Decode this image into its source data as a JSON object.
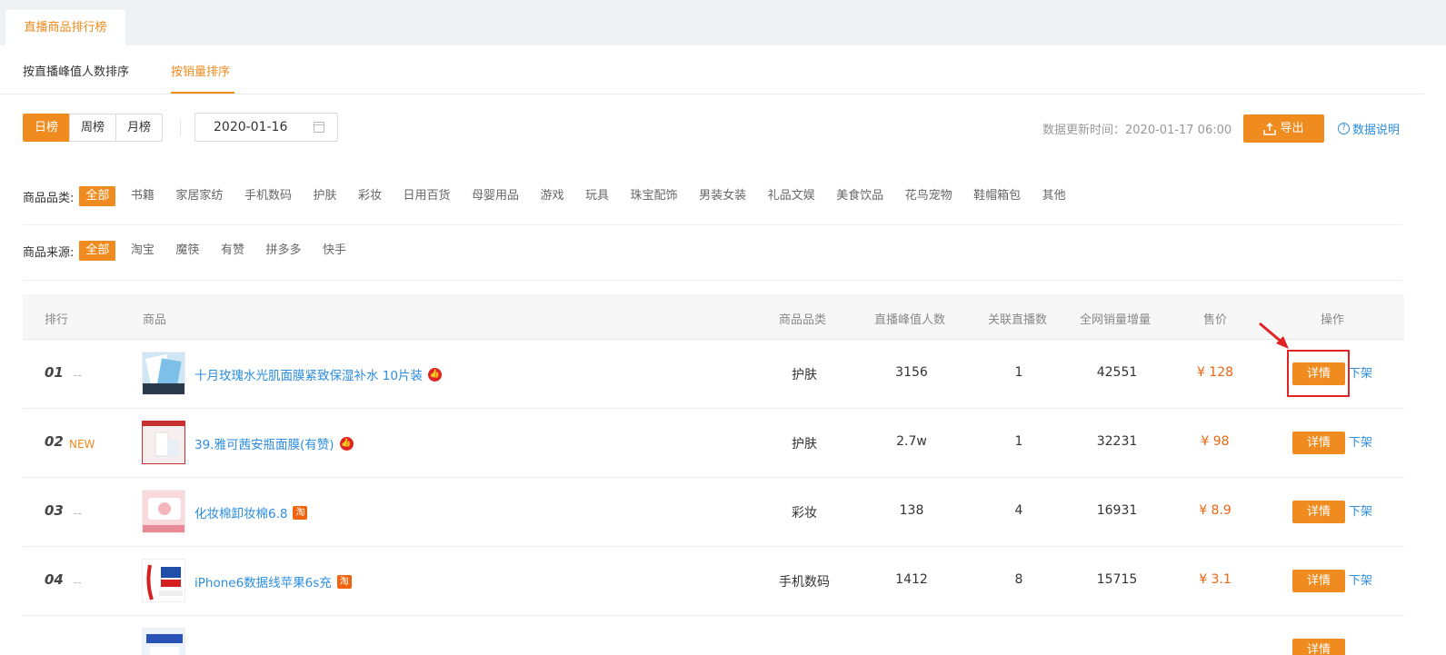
{
  "top_tab": "直播商品排行榜",
  "subtabs": [
    "按直播峰值人数排序",
    "按销量排序"
  ],
  "periods": [
    "日榜",
    "周榜",
    "月榜"
  ],
  "date_value": "2020-01-16",
  "update_text": "数据更新时间：2020-01-17 06:00",
  "export_label": "导出",
  "help_label": "数据说明",
  "category": {
    "label": "商品品类:",
    "options": [
      "全部",
      "书籍",
      "家居家纺",
      "手机数码",
      "护肤",
      "彩妆",
      "日用百货",
      "母婴用品",
      "游戏",
      "玩具",
      "珠宝配饰",
      "男装女装",
      "礼品文娱",
      "美食饮品",
      "花鸟宠物",
      "鞋帽箱包",
      "其他"
    ]
  },
  "source": {
    "label": "商品来源:",
    "options": [
      "全部",
      "淘宝",
      "魔筷",
      "有赞",
      "拼多多",
      "快手"
    ]
  },
  "table": {
    "headers": [
      "排行",
      "商品",
      "商品品类",
      "直播峰值人数",
      "关联直播数",
      "全网销量增量",
      "售价",
      "操作"
    ],
    "rows": [
      {
        "rank": "01",
        "trend": "--",
        "name": "十月玫瑰水光肌面膜紧致保湿补水 10片装",
        "badge": "hot",
        "category": "护肤",
        "peak": "3156",
        "lives": "1",
        "sales": "42551",
        "price": "¥ 128"
      },
      {
        "rank": "02",
        "trend": "NEW",
        "name": "39.雅可茜安瓶面膜(有赞)",
        "badge": "hot",
        "category": "护肤",
        "peak": "2.7w",
        "lives": "1",
        "sales": "32231",
        "price": "¥ 98"
      },
      {
        "rank": "03",
        "trend": "--",
        "name": "化妆棉卸妆棉6.8",
        "badge": "tao",
        "category": "彩妆",
        "peak": "138",
        "lives": "4",
        "sales": "16931",
        "price": "¥ 8.9"
      },
      {
        "rank": "04",
        "trend": "--",
        "name": "iPhone6数据线苹果6s充",
        "badge": "tao",
        "category": "手机数码",
        "peak": "1412",
        "lives": "8",
        "sales": "15715",
        "price": "¥ 3.1"
      }
    ],
    "detail_label": "详情",
    "off_label": "下架",
    "hot_glyph": "👍",
    "tao_glyph": "淘"
  },
  "colors": {
    "accent": "#ef8b1f",
    "link": "#2d8ee0",
    "price": "#f0640f",
    "annotation": "#e02424"
  }
}
